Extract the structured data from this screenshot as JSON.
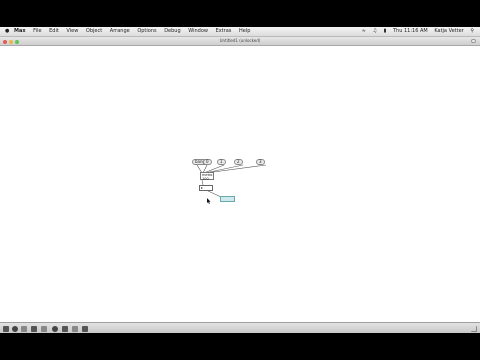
{
  "menubar": {
    "apple_icon": "apple-logo-icon",
    "app_name": "Max",
    "items": [
      "File",
      "Edit",
      "View",
      "Object",
      "Arrange",
      "Options",
      "Debug",
      "Window",
      "Extras",
      "Help"
    ],
    "clock": "Thu 11:16 AM",
    "user": "Katja Vetter"
  },
  "window": {
    "title": "Untitled1 (unlocked)"
  },
  "patch": {
    "messages": [
      "bang",
      "0",
      "1",
      "2",
      "3"
    ],
    "object_label": "metro",
    "object_sub": "100"
  }
}
